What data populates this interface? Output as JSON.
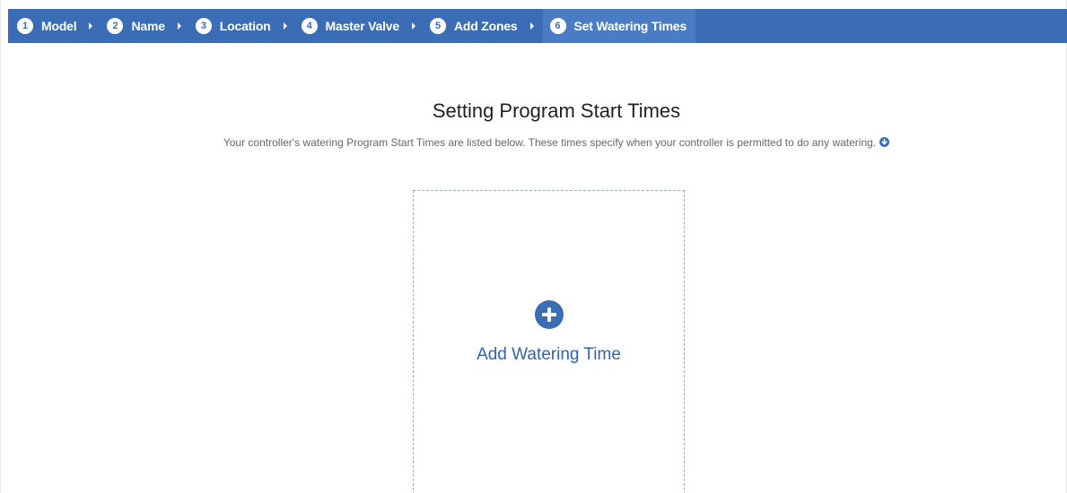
{
  "wizard": {
    "steps": [
      {
        "number": "1",
        "label": "Model"
      },
      {
        "number": "2",
        "label": "Name"
      },
      {
        "number": "3",
        "label": "Location"
      },
      {
        "number": "4",
        "label": "Master Valve"
      },
      {
        "number": "5",
        "label": "Add Zones"
      },
      {
        "number": "6",
        "label": "Set Watering Times"
      }
    ],
    "active_step": 6
  },
  "page": {
    "title": "Setting Program Start Times",
    "subtitle": "Your controller's watering Program Start Times are listed below. These times specify when your controller is permitted to do any watering."
  },
  "add_card": {
    "label": "Add Watering Time",
    "icon": "plus-circle-icon"
  },
  "colors": {
    "brand": "#3a6db5",
    "active_step_bg": "#4a7cc3",
    "link": "#2f63ad"
  }
}
